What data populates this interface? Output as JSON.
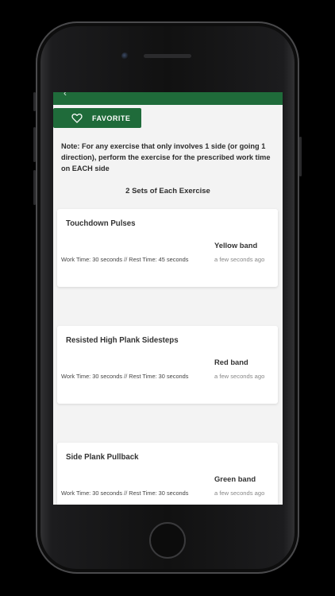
{
  "header": {
    "back_label": "‹"
  },
  "favorite": {
    "label": "FAVORITE",
    "icon": "heart-outline-icon"
  },
  "note": "Note: For any exercise that only involves 1 side (or going 1 direction), perform the exercise for the prescribed work time on EACH side",
  "sets_label": "2 Sets of Each Exercise",
  "exercises": [
    {
      "title": "Touchdown Pulses",
      "times": "Work Time: 30 seconds // Rest Time: 45 seconds",
      "band": "Yellow band",
      "updated": "a few seconds ago"
    },
    {
      "title": "Resisted High Plank Sidesteps",
      "times": "Work Time: 30 seconds // Rest Time: 30 seconds",
      "band": "Red band",
      "updated": "a few seconds ago"
    },
    {
      "title": "Side Plank Pullback",
      "times": "Work Time: 30 seconds // Rest Time: 30 seconds",
      "band": "Green band",
      "updated": "a few seconds ago"
    }
  ],
  "colors": {
    "brand_green": "#1f6b3a",
    "background": "#f3f3f3"
  }
}
